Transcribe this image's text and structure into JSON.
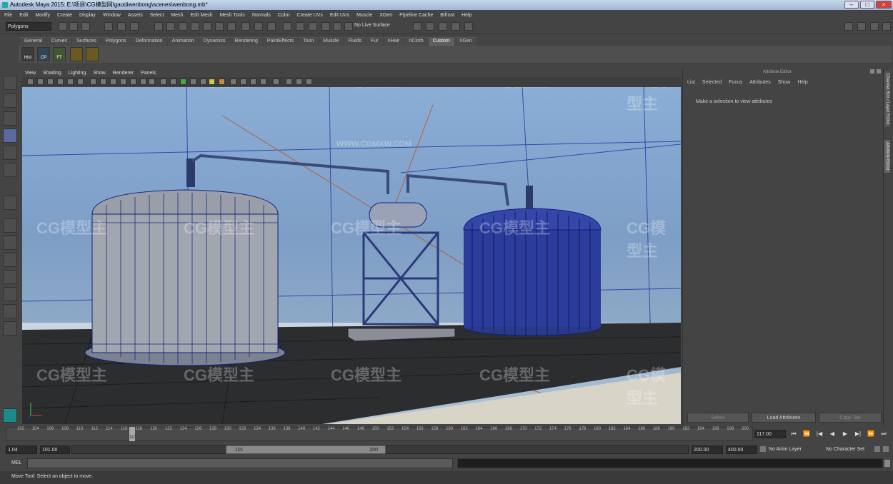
{
  "window": {
    "title": "Autodesk Maya 2015: E:\\项目\\CG模型网\\gaodiwenbong\\scenes\\wenbong.mb*"
  },
  "menubar": [
    "File",
    "Edit",
    "Modify",
    "Create",
    "Display",
    "Window",
    "Assets",
    "Select",
    "Mesh",
    "Edit Mesh",
    "Mesh Tools",
    "Normals",
    "Color",
    "Create UVs",
    "Edit UVs",
    "Muscle",
    "XGen",
    "Pipeline Cache",
    "Bifrost",
    "Help"
  ],
  "statusline": {
    "mode": "Polygons",
    "live_surface": "No Live Surface"
  },
  "shelf": {
    "tabs": [
      "General",
      "Curves",
      "Surfaces",
      "Polygons",
      "Deformation",
      "Animation",
      "Dynamics",
      "Rendering",
      "PaintEffects",
      "Toon",
      "Muscle",
      "Fluids",
      "Fur",
      "nHair",
      "nCloth",
      "Custom",
      "XGen"
    ],
    "active_tab": "Custom",
    "icons": [
      "Hist",
      "CP",
      "FT"
    ]
  },
  "viewport": {
    "menu": [
      "View",
      "Shading",
      "Lighting",
      "Show",
      "Renderer",
      "Panels"
    ],
    "watermark": "CG模型主",
    "watermark_url": "WWW.CGMXW.COM"
  },
  "attribute_editor": {
    "title": "Attribute Editor",
    "menu": [
      "List",
      "Selected",
      "Focus",
      "Attributes",
      "Show",
      "Help"
    ],
    "message": "Make a selection to view attributes",
    "buttons": [
      "Select",
      "Load Attributes",
      "Copy Tab"
    ]
  },
  "side_tabs": [
    "Channel Box / Layer Editor",
    "Attribute Editor"
  ],
  "timeline": {
    "ticks": [
      "102",
      "104",
      "106",
      "108",
      "110",
      "112",
      "114",
      "116",
      "118",
      "120",
      "122",
      "124",
      "126",
      "128",
      "130",
      "132",
      "134",
      "136",
      "138",
      "140",
      "142",
      "144",
      "146",
      "148",
      "150",
      "152",
      "154",
      "156",
      "158",
      "160",
      "162",
      "164",
      "166",
      "168",
      "170",
      "172",
      "174",
      "176",
      "178",
      "180",
      "182",
      "184",
      "186",
      "188",
      "190",
      "192",
      "194",
      "196",
      "198",
      "200"
    ],
    "current_marker": "117",
    "current_frame": "117.00",
    "start": 102,
    "end": 200,
    "current": 117
  },
  "range": {
    "start_time": "1.04",
    "playback_start": "101.00",
    "handle_start": "101",
    "handle_end": "200",
    "playback_end": "200.00",
    "end_time": "400.00",
    "anim_layer": "No Anim Layer",
    "character_set": "No Character Set"
  },
  "commandline": {
    "label": "MEL"
  },
  "helpline": "Move Tool: Select an object to move."
}
